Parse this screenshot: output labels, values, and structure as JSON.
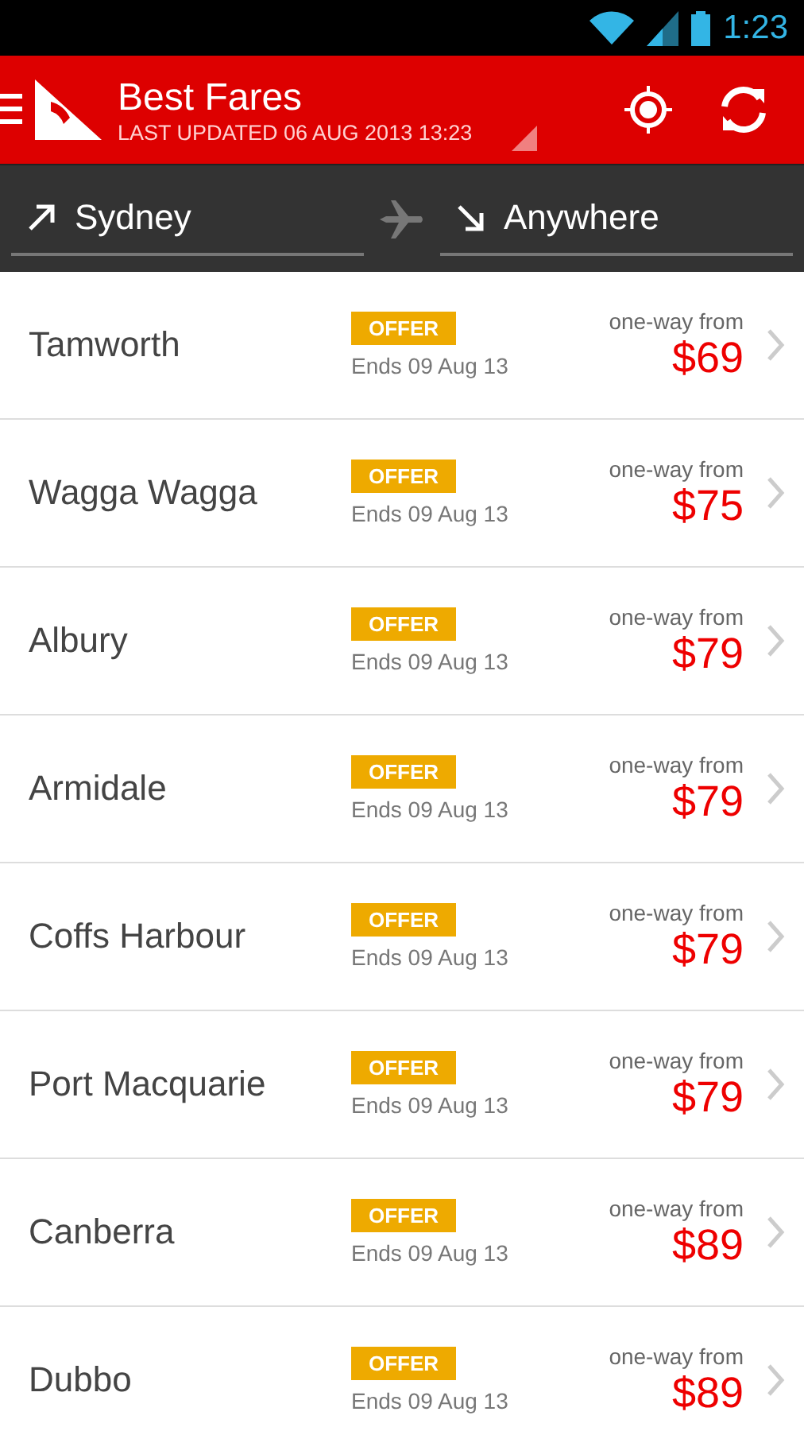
{
  "status_bar": {
    "time": "1:23"
  },
  "header": {
    "title": "Best Fares",
    "subtitle": "LAST UPDATED 06 AUG 2013 13:23"
  },
  "route": {
    "origin": "Sydney",
    "destination": "Anywhere"
  },
  "fares": [
    {
      "city": "Tamworth",
      "badge": "OFFER",
      "ends": "Ends 09 Aug 13",
      "label": "one-way from",
      "price": "$69"
    },
    {
      "city": "Wagga Wagga",
      "badge": "OFFER",
      "ends": "Ends 09 Aug 13",
      "label": "one-way from",
      "price": "$75"
    },
    {
      "city": "Albury",
      "badge": "OFFER",
      "ends": "Ends 09 Aug 13",
      "label": "one-way from",
      "price": "$79"
    },
    {
      "city": "Armidale",
      "badge": "OFFER",
      "ends": "Ends 09 Aug 13",
      "label": "one-way from",
      "price": "$79"
    },
    {
      "city": "Coffs Harbour",
      "badge": "OFFER",
      "ends": "Ends 09 Aug 13",
      "label": "one-way from",
      "price": "$79"
    },
    {
      "city": "Port Macquarie",
      "badge": "OFFER",
      "ends": "Ends 09 Aug 13",
      "label": "one-way from",
      "price": "$79"
    },
    {
      "city": "Canberra",
      "badge": "OFFER",
      "ends": "Ends 09 Aug 13",
      "label": "one-way from",
      "price": "$89"
    },
    {
      "city": "Dubbo",
      "badge": "OFFER",
      "ends": "Ends 09 Aug 13",
      "label": "one-way from",
      "price": "$89"
    }
  ]
}
